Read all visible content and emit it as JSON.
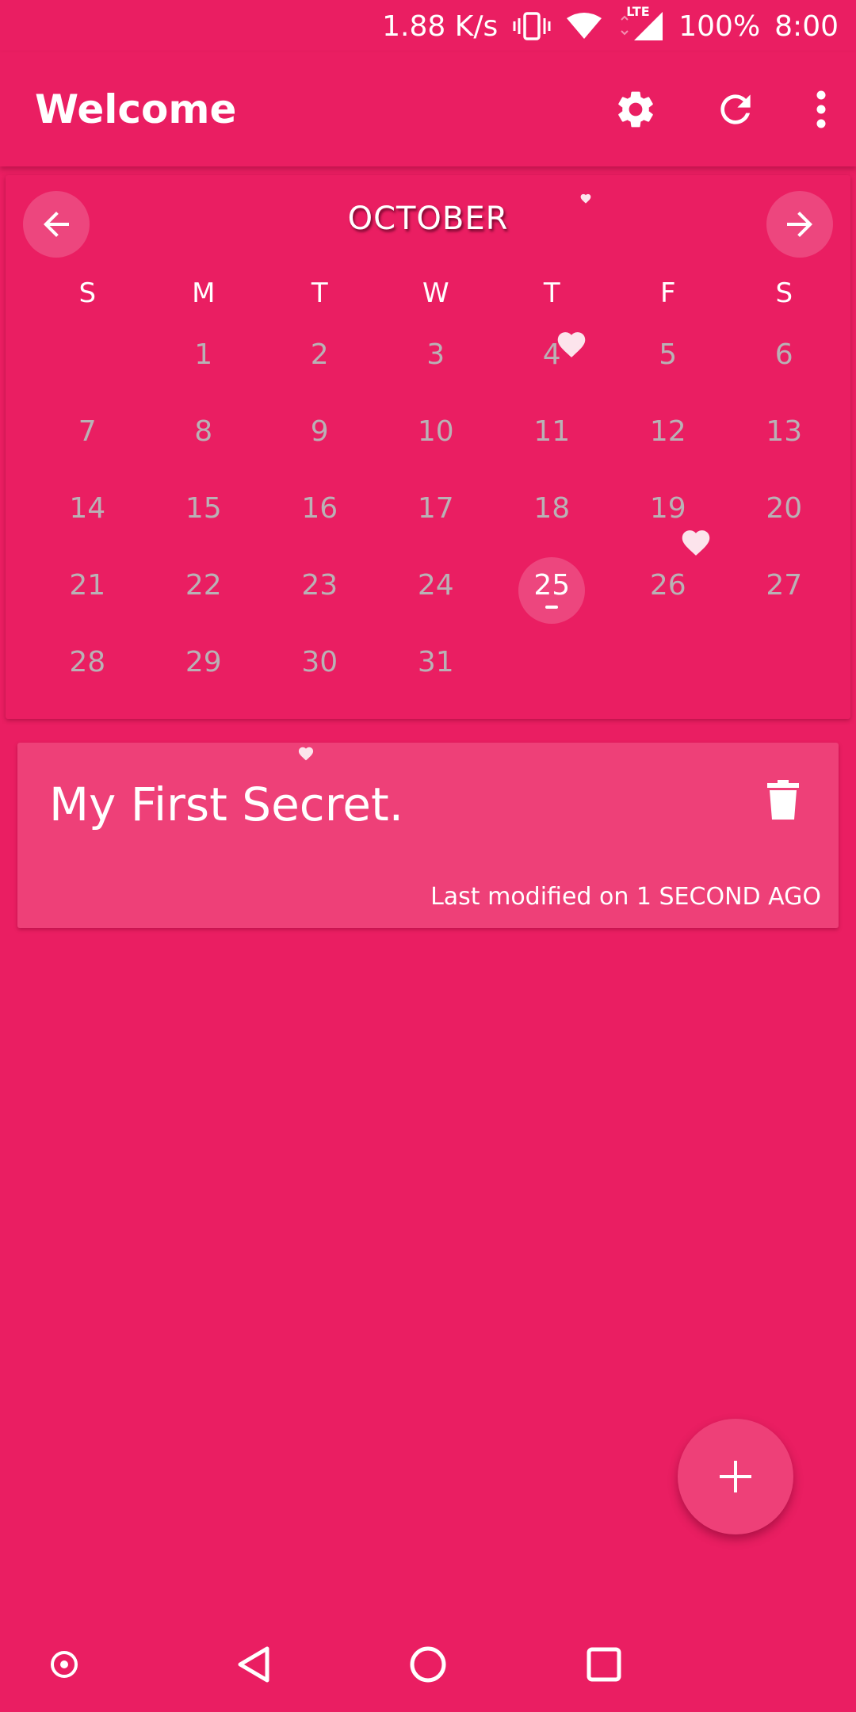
{
  "status_bar": {
    "net_speed": "1.88 K/s",
    "network_type": "LTE",
    "battery": "100%",
    "time": "8:00",
    "icons": [
      "vibrate-icon",
      "wifi-icon",
      "lte-signal-icon"
    ]
  },
  "app_bar": {
    "title": "Welcome",
    "actions": [
      "settings-icon",
      "refresh-icon",
      "more-vert-icon"
    ]
  },
  "calendar": {
    "month": "OCTOBER",
    "weekdays": [
      "S",
      "M",
      "T",
      "W",
      "T",
      "F",
      "S"
    ],
    "weeks": [
      [
        "",
        "1",
        "2",
        "3",
        "4",
        "5",
        "6"
      ],
      [
        "7",
        "8",
        "9",
        "10",
        "11",
        "12",
        "13"
      ],
      [
        "14",
        "15",
        "16",
        "17",
        "18",
        "19",
        "20"
      ],
      [
        "21",
        "22",
        "23",
        "24",
        "25",
        "26",
        "27"
      ],
      [
        "28",
        "29",
        "30",
        "31",
        "",
        "",
        ""
      ]
    ],
    "selected_day": "25"
  },
  "secret": {
    "title": "My First Secret.",
    "meta": "Last modified on 1 SECOND AGO"
  },
  "fab": {
    "icon": "plus-icon"
  },
  "colors": {
    "background": "#EA1E62",
    "card": "#EE4078",
    "muted_text": "#B9B1B5",
    "heart": "#FCE4EC"
  },
  "nav_bar": {
    "icons": [
      "record-icon",
      "back-icon",
      "home-icon",
      "recents-icon"
    ]
  }
}
